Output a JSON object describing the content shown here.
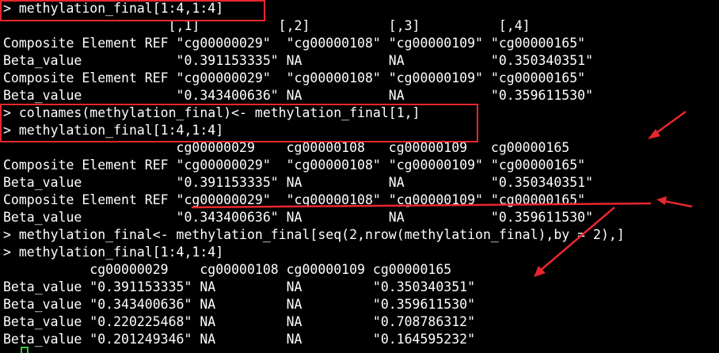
{
  "terminal": {
    "lines": [
      "> methylation_final[1:4,1:4]",
      "                     [,1]          [,2]          [,3]          [,4]",
      "Composite Element REF \"cg00000029\"  \"cg00000108\" \"cg00000109\" \"cg00000165\"",
      "Beta_value            \"0.391153335\" NA           NA           \"0.350340351\"",
      "Composite Element REF \"cg00000029\"  \"cg00000108\" \"cg00000109\" \"cg00000165\"",
      "Beta_value            \"0.343400636\" NA           NA           \"0.359611530\"",
      "> colnames(methylation_final)<- methylation_final[1,]",
      "> methylation_final[1:4,1:4]",
      "                      cg00000029    cg00000108   cg00000109   cg00000165",
      "Composite Element REF \"cg00000029\"  \"cg00000108\" \"cg00000109\" \"cg00000165\"",
      "Beta_value            \"0.391153335\" NA           NA           \"0.350340351\"",
      "Composite Element REF \"cg00000029\"  \"cg00000108\" \"cg00000109\" \"cg00000165\"",
      "Beta_value            \"0.343400636\" NA           NA           \"0.359611530\"",
      "> methylation_final<- methylation_final[seq(2,nrow(methylation_final),by = 2),]",
      "> methylation_final[1:4,1:4]",
      "           cg00000029    cg00000108 cg00000109 cg00000165",
      "Beta_value \"0.391153335\" NA         NA         \"0.350340351\"",
      "Beta_value \"0.343400636\" NA         NA         \"0.359611530\"",
      "Beta_value \"0.220225468\" NA         NA         \"0.708786312\"",
      "Beta_value \"0.201249346\" NA         NA         \"0.164595232\""
    ]
  },
  "annotation_color": "#e8262d",
  "cursor_color": "#2ecc40"
}
